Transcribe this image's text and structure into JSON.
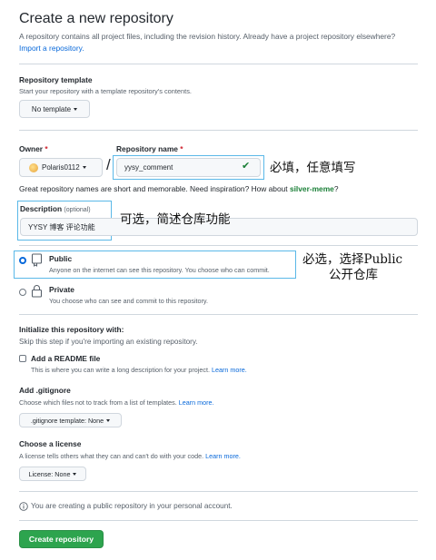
{
  "header": {
    "title": "Create a new repository",
    "intro": "A repository contains all project files, including the revision history. Already have a project repository elsewhere?",
    "import_link": "Import a repository."
  },
  "template": {
    "label": "Repository template",
    "hint": "Start your repository with a template repository's contents.",
    "button": "No template"
  },
  "owner": {
    "label": "Owner",
    "required": "*",
    "value": "Polaris0112",
    "separator": "/"
  },
  "repo_name": {
    "label": "Repository name",
    "required": "*",
    "value": "yysy_comment",
    "check": "✔"
  },
  "name_hint": {
    "text": "Great repository names are short and memorable. Need inspiration? How about",
    "suggestion": "silver-meme",
    "end": "?"
  },
  "description": {
    "label": "Description",
    "optional": "(optional)",
    "value": "YYSY 博客 评论功能"
  },
  "visibility": {
    "public_title": "Public",
    "public_desc": "Anyone on the internet can see this repository. You choose who can commit.",
    "private_title": "Private",
    "private_desc": "You choose who can see and commit to this repository."
  },
  "init": {
    "title": "Initialize this repository with:",
    "hint": "Skip this step if you're importing an existing repository.",
    "readme_title": "Add a README file",
    "readme_desc": "This is where you can write a long description for your project.",
    "readme_link": "Learn more."
  },
  "gitignore": {
    "title": "Add .gitignore",
    "hint": "Choose which files not to track from a list of templates.",
    "link": "Learn more.",
    "button": ".gitignore template: None"
  },
  "license": {
    "title": "Choose a license",
    "hint": "A license tells others what they can and can't do with your code.",
    "link": "Learn more.",
    "button": "License: None"
  },
  "notice": {
    "icon": "info-icon",
    "text": "You are creating a public repository in your personal account."
  },
  "submit": {
    "label": "Create repository"
  },
  "annotations": {
    "name_note": "必填，任意填写",
    "desc_note": "可选，简述仓库功能",
    "public_note_1": "必选，选择Public",
    "public_note_2": "公开仓库"
  },
  "colors": {
    "annotation_box": "#5ab8e8",
    "primary_button": "#2da44e",
    "link": "#0969da",
    "required": "#cf222e"
  }
}
